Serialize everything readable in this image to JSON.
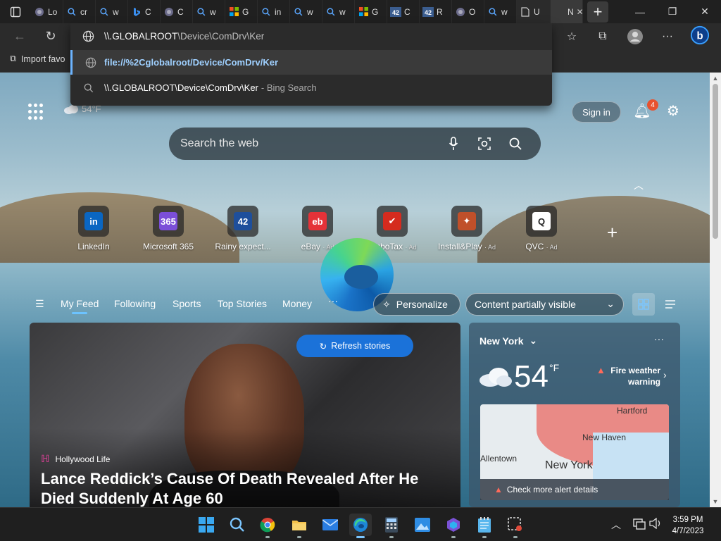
{
  "browser": {
    "tabs": [
      {
        "label": "Lo",
        "icon": "site-icon"
      },
      {
        "label": "cr",
        "icon": "search-icon"
      },
      {
        "label": "w",
        "icon": "search-icon"
      },
      {
        "label": "C",
        "icon": "bing-icon"
      },
      {
        "label": "C",
        "icon": "site-icon"
      },
      {
        "label": "w",
        "icon": "search-icon"
      },
      {
        "label": "G",
        "icon": "microsoft-icon"
      },
      {
        "label": "in",
        "icon": "search-icon"
      },
      {
        "label": "w",
        "icon": "search-icon"
      },
      {
        "label": "w",
        "icon": "search-icon"
      },
      {
        "label": "G",
        "icon": "microsoft-icon"
      },
      {
        "label": "C",
        "icon": "cbs-icon"
      },
      {
        "label": "R",
        "icon": "cbs-icon"
      },
      {
        "label": "O",
        "icon": "site-icon"
      },
      {
        "label": "w",
        "icon": "search-icon"
      },
      {
        "label": "U",
        "icon": "page-icon"
      },
      {
        "label": "N",
        "icon": "none"
      }
    ],
    "favorites_bar": {
      "import_label": "Import favo"
    },
    "omnibox": {
      "value_host": "\\\\.GLOBALROOT",
      "value_path": "\\Device\\ComDrv\\Ker",
      "suggestions": [
        {
          "text": "file://%2Cglobalroot/Device/ComDrv/Ker",
          "sub": ""
        },
        {
          "text": "\\\\.GLOBALROOT\\Device\\ComDrv\\Ker",
          "sub": "- Bing Search"
        }
      ]
    }
  },
  "newtab": {
    "weather_temp": "54°F",
    "signin_label": "Sign in",
    "notification_count": "4",
    "search_placeholder": "Search the web",
    "quick_links": [
      {
        "label": "LinkedIn",
        "ad": "",
        "tile": "in",
        "color": "#0a66c2"
      },
      {
        "label": "Microsoft 365",
        "ad": "",
        "tile": "365",
        "color": "#7b4ed8"
      },
      {
        "label": "Rainy expect...",
        "ad": "",
        "tile": "42",
        "color": "#1e4f9c"
      },
      {
        "label": "eBay",
        "ad": "· Ad",
        "tile": "eb",
        "color": "#e53238"
      },
      {
        "label": "TurboTax",
        "ad": "· Ad",
        "tile": "✔",
        "color": "#d52b1e"
      },
      {
        "label": "Install&Play",
        "ad": "· Ad",
        "tile": "✦",
        "color": "#c0502a"
      },
      {
        "label": "QVC",
        "ad": "· Ad",
        "tile": "Q",
        "color": "#ffffff"
      }
    ],
    "feed_nav": {
      "items": [
        "My Feed",
        "Following",
        "Sports",
        "Top Stories",
        "Money"
      ],
      "more": "···",
      "personalize": "Personalize",
      "content_visibility": "Content partially visible"
    },
    "refresh_label": "Refresh stories",
    "hero": {
      "source": "Hollywood Life",
      "title": "Lance Reddick’s Cause Of Death Revealed After He Died Suddenly At Age 60"
    },
    "weather_card": {
      "city": "New York",
      "temp": "54",
      "unit": "°F",
      "alert": "Fire weather warning",
      "map_labels": [
        "Hartford",
        "New Haven",
        "Allentown",
        "New York"
      ],
      "check_alerts": "Check more alert details"
    }
  },
  "taskbar": {
    "time": "3:59 PM",
    "date": "4/7/2023"
  }
}
